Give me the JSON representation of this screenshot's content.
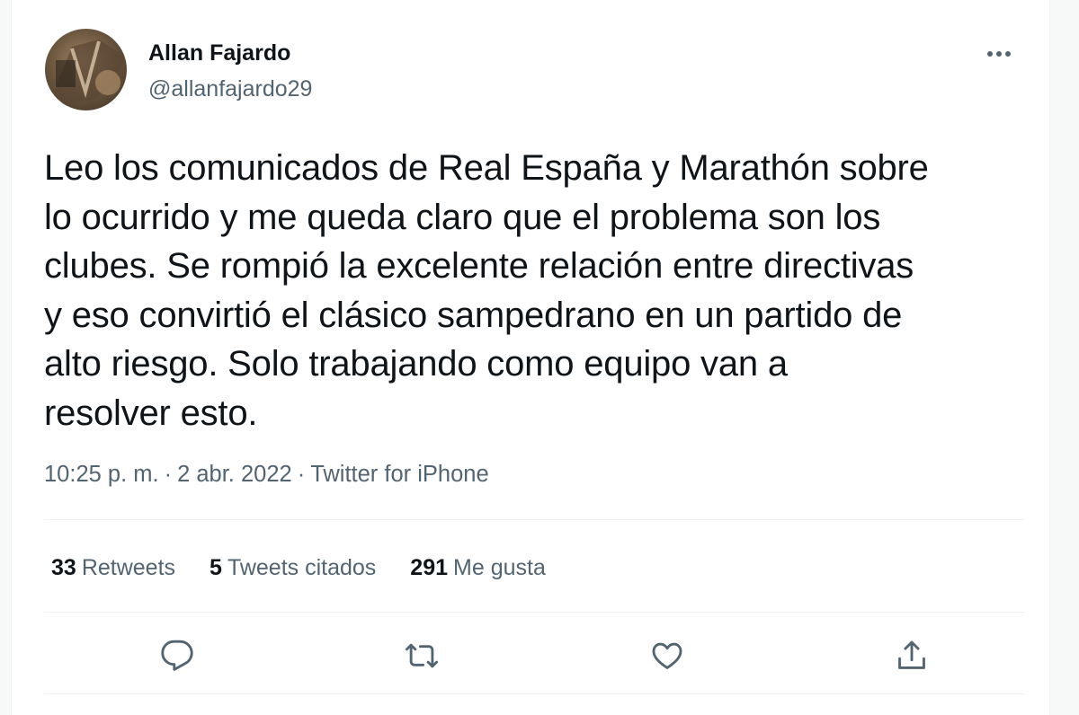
{
  "author": {
    "name": "Allan Fajardo",
    "handle": "@allanfajardo29"
  },
  "tweet": {
    "text": "Leo los comunicados de Real España y Marathón sobre\nlo ocurrido y me queda claro que el problema son los\nclubes. Se rompió la excelente relación entre directivas\ny eso convirtió el clásico sampedrano en un partido de\nalto riesgo. Solo trabajando como equipo van a\nresolver esto."
  },
  "meta": {
    "time": "10:25 p. m.",
    "date": "2 abr. 2022",
    "source": "Twitter for iPhone",
    "separator": "·"
  },
  "stats": {
    "retweets_count": "33",
    "retweets_label": "Retweets",
    "quotes_count": "5",
    "quotes_label": "Tweets citados",
    "likes_count": "291",
    "likes_label": "Me gusta"
  },
  "icons": {
    "more": "more-icon",
    "reply": "reply-icon",
    "retweet": "retweet-icon",
    "like": "like-icon",
    "share": "share-icon"
  },
  "colors": {
    "text_primary": "#0f1419",
    "text_secondary": "#536471",
    "divider": "#eff3f4"
  }
}
